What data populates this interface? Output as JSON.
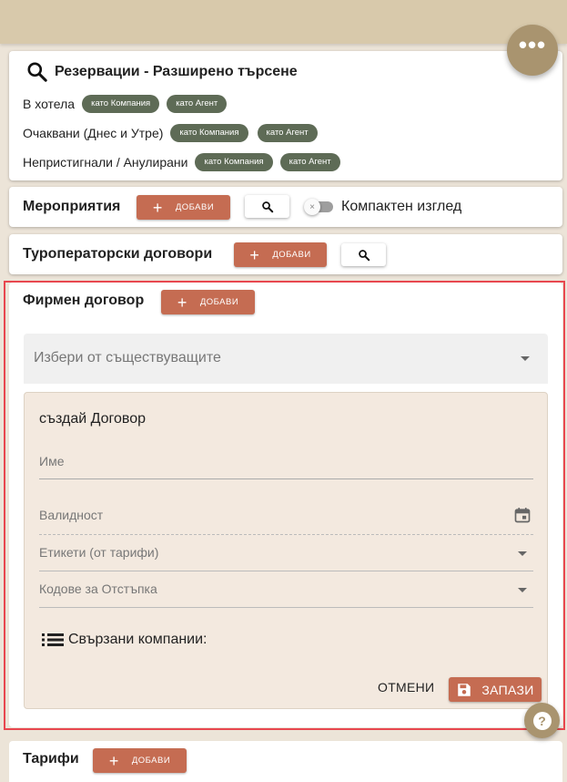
{
  "more_button": {
    "label": "•••"
  },
  "reservations": {
    "title": "Резервации - Разширено търсене",
    "rows": [
      {
        "label": "В хотела",
        "chips": [
          "като Компания",
          "като Агент"
        ]
      },
      {
        "label": "Очаквани (Днес и Утре)",
        "chips": [
          "като Компания",
          "като Агент"
        ]
      },
      {
        "label": "Непристигнали / Анулирани",
        "chips": [
          "като Компания",
          "като Агент"
        ]
      }
    ]
  },
  "events": {
    "title": "Мероприятия",
    "add_label": "ДОБАВИ",
    "compact_label": "Компактен изглед",
    "compact_on": false
  },
  "tour_contracts": {
    "title": "Туроператорски договори",
    "add_label": "ДОБАВИ"
  },
  "firm_contract": {
    "title": "Фирмен договор",
    "add_label": "ДОБАВИ",
    "select_placeholder": "Избери от съществуващите",
    "create": {
      "title": "създай Договор",
      "name_label": "Име",
      "validity_label": "Валидност",
      "tags_label": "Етикети (от тарифи)",
      "codes_label": "Кодове за Отстъпка",
      "linked_label": "Свързани компании:",
      "cancel_label": "ОТМЕНИ",
      "save_label": "ЗАПАЗИ"
    }
  },
  "tariffs": {
    "title": "Тарифи",
    "add_label": "ДОБАВИ"
  },
  "help_button": {
    "label": "?"
  },
  "colors": {
    "accent": "#c56c52",
    "chip": "#5e6b56",
    "brand": "#a9946f",
    "highlight": "#e8474f"
  }
}
